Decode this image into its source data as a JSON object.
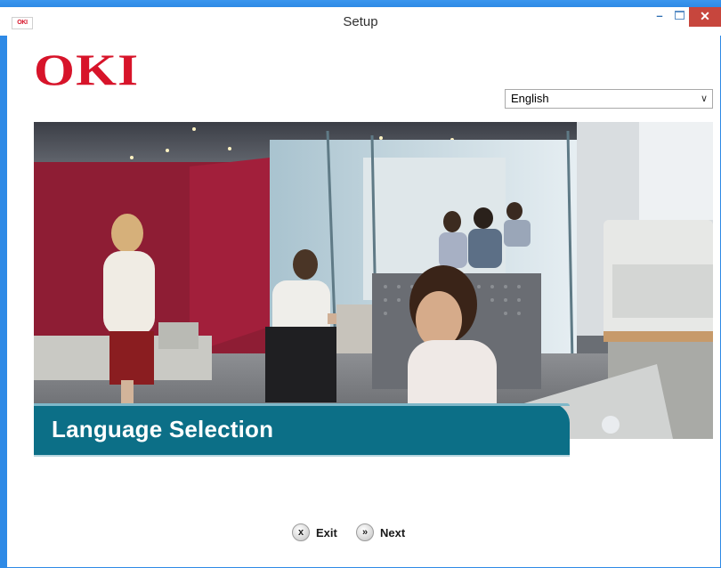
{
  "window": {
    "title": "Setup",
    "icon_text": "OKI",
    "minimize_glyph": "–",
    "close_glyph": "✕"
  },
  "header": {
    "logo_text": "OKI",
    "language_select": {
      "selected": "English",
      "chevron": "∨"
    }
  },
  "banner": {
    "image": "office-photo",
    "section_title": "Language Selection"
  },
  "footer": {
    "exit_label": "Exit",
    "exit_icon": "close-icon",
    "exit_glyph": "x",
    "next_label": "Next",
    "next_icon": "next-icon",
    "next_glyph": "»"
  },
  "colors": {
    "brand_red": "#d7142a",
    "band_teal": "#0c6f87",
    "window_border": "#2e8ae6",
    "close_button": "#c7463d"
  }
}
